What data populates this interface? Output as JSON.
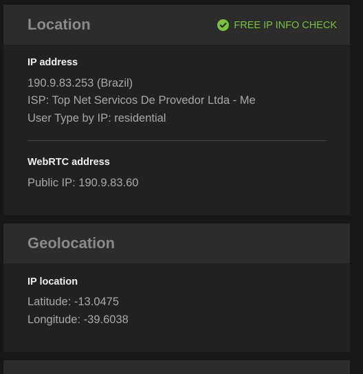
{
  "location": {
    "title": "Location",
    "badge": {
      "label": "FREE IP INFO CHECK",
      "icon": "check-circle-icon",
      "color": "#7ac142"
    },
    "ip_section": {
      "label": "IP address",
      "lines": [
        "190.9.83.253 (Brazil)",
        "ISP: Top Net Servicos De Provedor Ltda - Me",
        "User Type by IP: residential"
      ]
    },
    "webrtc_section": {
      "label": "WebRTC address",
      "lines": [
        "Public IP: 190.9.83.60"
      ]
    }
  },
  "geolocation": {
    "title": "Geolocation",
    "ip_location": {
      "label": "IP location",
      "lines": [
        "Latitude: -13.0475",
        "Longitude: -39.6038"
      ]
    }
  }
}
